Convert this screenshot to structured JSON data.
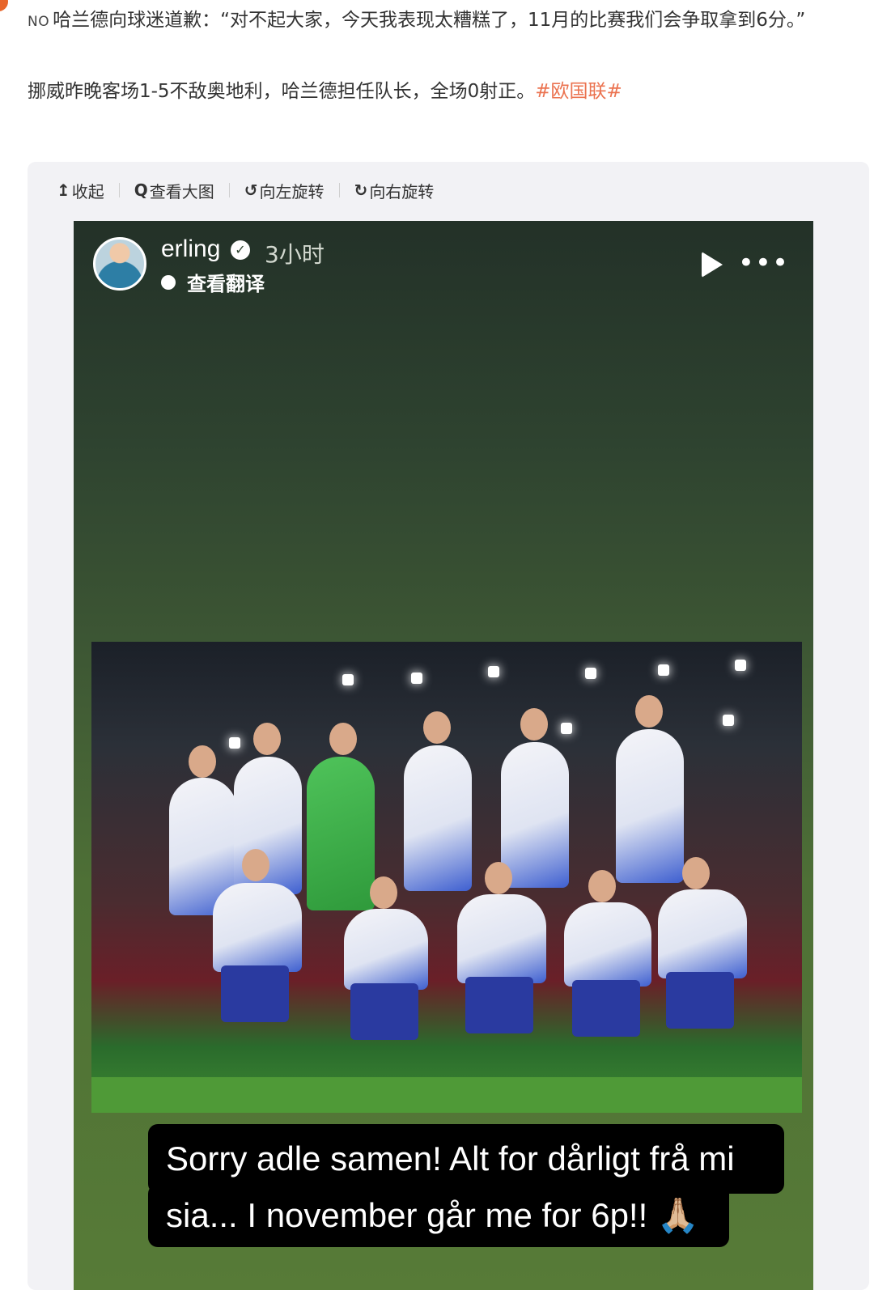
{
  "post": {
    "lead_code": "NO",
    "line1": "哈兰德向球迷道歉：“对不起大家，今天我表现太糟糕了，11月的比赛我们会争取拿到6分。”",
    "para2_text": "挪威昨晚客场1-5不敌奥地利，哈兰德担任队长，全场0射正。",
    "topic_tag": "#欧国联#"
  },
  "toolbar": {
    "collapse": "收起",
    "view_large": "查看大图",
    "rotate_left": "向左旋转",
    "rotate_right": "向右旋转"
  },
  "story": {
    "username": "erling",
    "time": "3小时",
    "translate_label": "查看翻译",
    "caption_line1": "Sorry adle samen! Alt for dårligt frå mi",
    "caption_line2": "sia... I november går me for 6p!! 🙏🏼"
  },
  "colors": {
    "topic": "#eb7350",
    "card_bg": "#f2f2f5",
    "story_top": "#233128",
    "story_bottom": "#577b37"
  }
}
